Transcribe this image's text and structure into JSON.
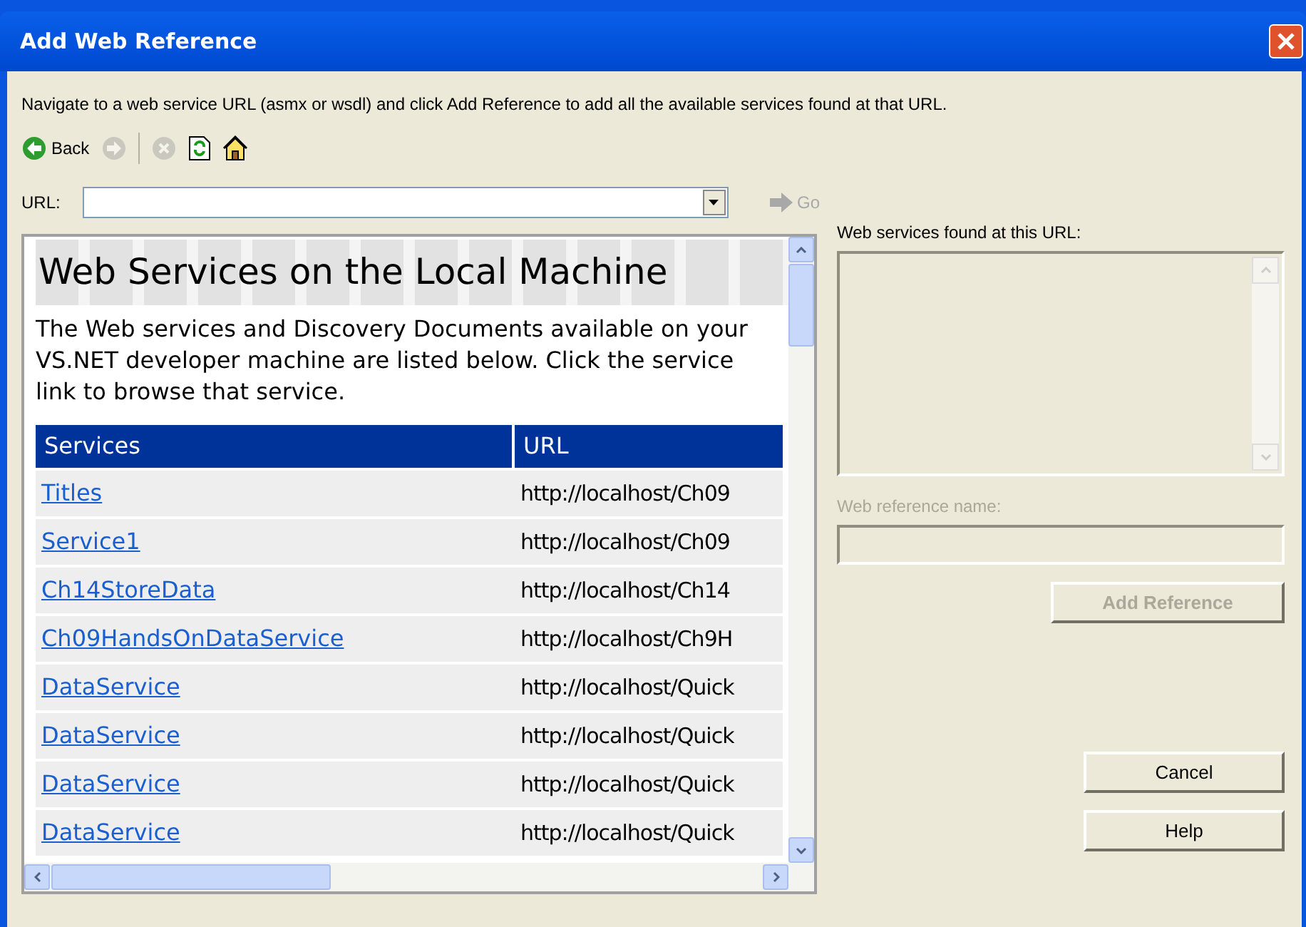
{
  "window": {
    "title": "Add Web Reference"
  },
  "instructions": "Navigate to a web service URL (asmx or wsdl) and click Add Reference to add all the available services found at that URL.",
  "toolbar": [
    {
      "kind": "back",
      "label": "Back",
      "disabled": false
    },
    {
      "kind": "forward",
      "disabled": true
    },
    {
      "kind": "separator"
    },
    {
      "kind": "stop",
      "disabled": true
    },
    {
      "kind": "refresh",
      "disabled": false
    },
    {
      "kind": "home",
      "disabled": false
    }
  ],
  "url_field": {
    "label": "URL:"
  },
  "go_button": {
    "label": "Go",
    "disabled": true
  },
  "browser": {
    "heading": "Web Services on the Local Machine",
    "intro": "The Web services and Discovery Documents available on your VS.NET developer machine are listed below. Click the service link to browse that service.",
    "table": {
      "columns": [
        "Services",
        "URL"
      ],
      "rows": [
        {
          "service": "Titles",
          "url": "http://localhost/Ch09"
        },
        {
          "service": "Service1",
          "url": "http://localhost/Ch09"
        },
        {
          "service": "Ch14StoreData",
          "url": "http://localhost/Ch14"
        },
        {
          "service": "Ch09HandsOnDataService",
          "url": "http://localhost/Ch9H"
        },
        {
          "service": "DataService",
          "url": "http://localhost/Quick"
        },
        {
          "service": "DataService",
          "url": "http://localhost/Quick"
        },
        {
          "service": "DataService",
          "url": "http://localhost/Quick"
        },
        {
          "service": "DataService",
          "url": "http://localhost/Quick"
        }
      ]
    }
  },
  "services_found": {
    "label": "Web services found at this URL:"
  },
  "reference_name": {
    "label": "Web reference name:",
    "disabled": true
  },
  "buttons": [
    {
      "kind": "add",
      "label": "Add Reference",
      "disabled": true
    },
    {
      "kind": "cancel",
      "label": "Cancel",
      "disabled": false
    },
    {
      "kind": "help",
      "label": "Help",
      "disabled": false
    }
  ]
}
